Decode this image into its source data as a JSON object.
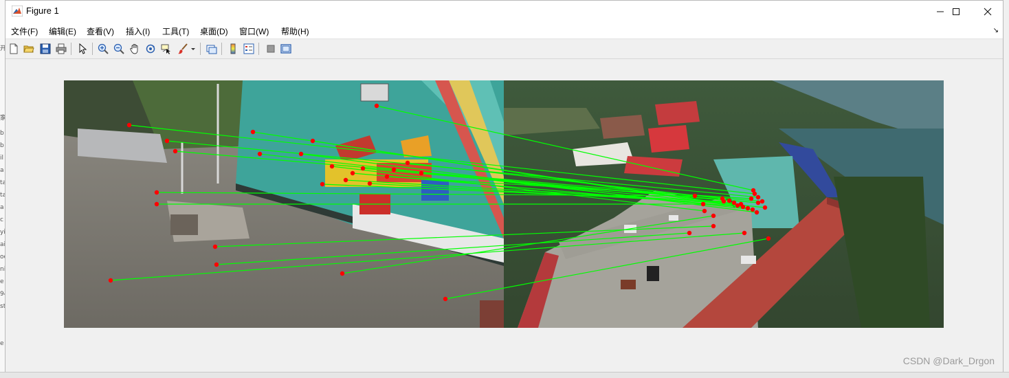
{
  "window": {
    "title": "Figure 1",
    "controls": {
      "minimize": "—",
      "maximize": "☐",
      "close": "✕"
    }
  },
  "menu": [
    "文件(F)",
    "编辑(E)",
    "查看(V)",
    "插入(I)",
    "工具(T)",
    "桌面(D)",
    "窗口(W)",
    "帮助(H)"
  ],
  "toolbar": {
    "icons": [
      "new-figure-icon",
      "open-file-icon",
      "save-icon",
      "print-icon",
      "pointer-icon",
      "zoom-in-icon",
      "zoom-out-icon",
      "pan-hand-icon",
      "rotate-3d-icon",
      "data-cursor-icon",
      "brush-icon",
      "brush-dropdown-icon",
      "link-plot-icon",
      "colorbar-icon",
      "legend-icon",
      "hide-plot-tools-icon",
      "show-plot-tools-icon"
    ]
  },
  "figure": {
    "line_color": "#00ff00",
    "point_color": "#ff0000",
    "images": [
      "playground-ground-view",
      "village-aerial-view"
    ]
  },
  "watermark": "CSDN @Dark_Drgon",
  "desktop_fragments": [
    "开",
    "家",
    "b",
    "b",
    "il",
    "a",
    "ta",
    "ta",
    "a",
    "c",
    "yi",
    "ai",
    "oc",
    "ni",
    "e",
    "94",
    "st",
    "e"
  ]
}
